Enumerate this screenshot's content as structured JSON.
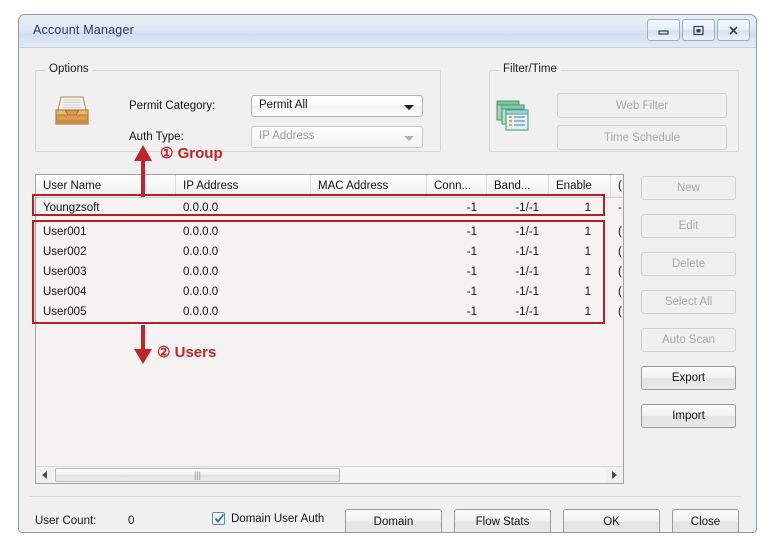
{
  "window": {
    "title": "Account Manager",
    "controls": [
      {
        "name": "minimize",
        "glyph": "minimize-icon"
      },
      {
        "name": "maximize",
        "glyph": "maximize-icon"
      },
      {
        "name": "close",
        "glyph": "close-icon"
      }
    ]
  },
  "options": {
    "legend": "Options",
    "icon": "inbox-tray-icon",
    "permit_category": {
      "label": "Permit Category:",
      "value": "Permit All",
      "enabled": true
    },
    "auth_type": {
      "label": "Auth Type:",
      "value": "IP Address",
      "enabled": false
    }
  },
  "filter_time": {
    "legend": "Filter/Time",
    "icon": "stacked-windows-icon",
    "buttons": [
      {
        "label": "Web Filter",
        "enabled": false
      },
      {
        "label": "Time Schedule",
        "enabled": false
      }
    ]
  },
  "table": {
    "columns": [
      "User Name",
      "IP Address",
      "MAC Address",
      "Conn...",
      "Band...",
      "Enable",
      "("
    ],
    "rows": [
      {
        "user_name": "Youngzsoft",
        "ip_address": "0.0.0.0",
        "mac_address": "",
        "conn": "-1",
        "band": "-1/-1",
        "enable": "1",
        "extra": "-"
      },
      {
        "user_name": "User001",
        "ip_address": "0.0.0.0",
        "mac_address": "",
        "conn": "-1",
        "band": "-1/-1",
        "enable": "1",
        "extra": "("
      },
      {
        "user_name": "User002",
        "ip_address": "0.0.0.0",
        "mac_address": "",
        "conn": "-1",
        "band": "-1/-1",
        "enable": "1",
        "extra": "("
      },
      {
        "user_name": "User003",
        "ip_address": "0.0.0.0",
        "mac_address": "",
        "conn": "-1",
        "band": "-1/-1",
        "enable": "1",
        "extra": "("
      },
      {
        "user_name": "User004",
        "ip_address": "0.0.0.0",
        "mac_address": "",
        "conn": "-1",
        "band": "-1/-1",
        "enable": "1",
        "extra": "("
      },
      {
        "user_name": "User005",
        "ip_address": "0.0.0.0",
        "mac_address": "",
        "conn": "-1",
        "band": "-1/-1",
        "enable": "1",
        "extra": "("
      }
    ]
  },
  "side_buttons": [
    {
      "label": "New",
      "enabled": false
    },
    {
      "label": "Edit",
      "enabled": false
    },
    {
      "label": "Delete",
      "enabled": false
    },
    {
      "label": "Select All",
      "enabled": false
    },
    {
      "label": "Auto Scan",
      "enabled": false
    },
    {
      "label": "Export",
      "enabled": true
    },
    {
      "label": "Import",
      "enabled": true
    }
  ],
  "footer": {
    "user_count_label": "User Count:",
    "user_count_value": "0",
    "domain_user_auth": {
      "label": "Domain User Auth",
      "checked": true
    },
    "buttons": [
      {
        "label": "Domain",
        "enabled": true
      },
      {
        "label": "Flow Stats",
        "enabled": true
      },
      {
        "label": "OK",
        "enabled": true
      },
      {
        "label": "Close",
        "enabled": true
      }
    ]
  },
  "annotations": {
    "color": "#c0252a",
    "group": {
      "marker": "①",
      "text": "Group"
    },
    "users": {
      "marker": "②",
      "text": "Users"
    }
  }
}
